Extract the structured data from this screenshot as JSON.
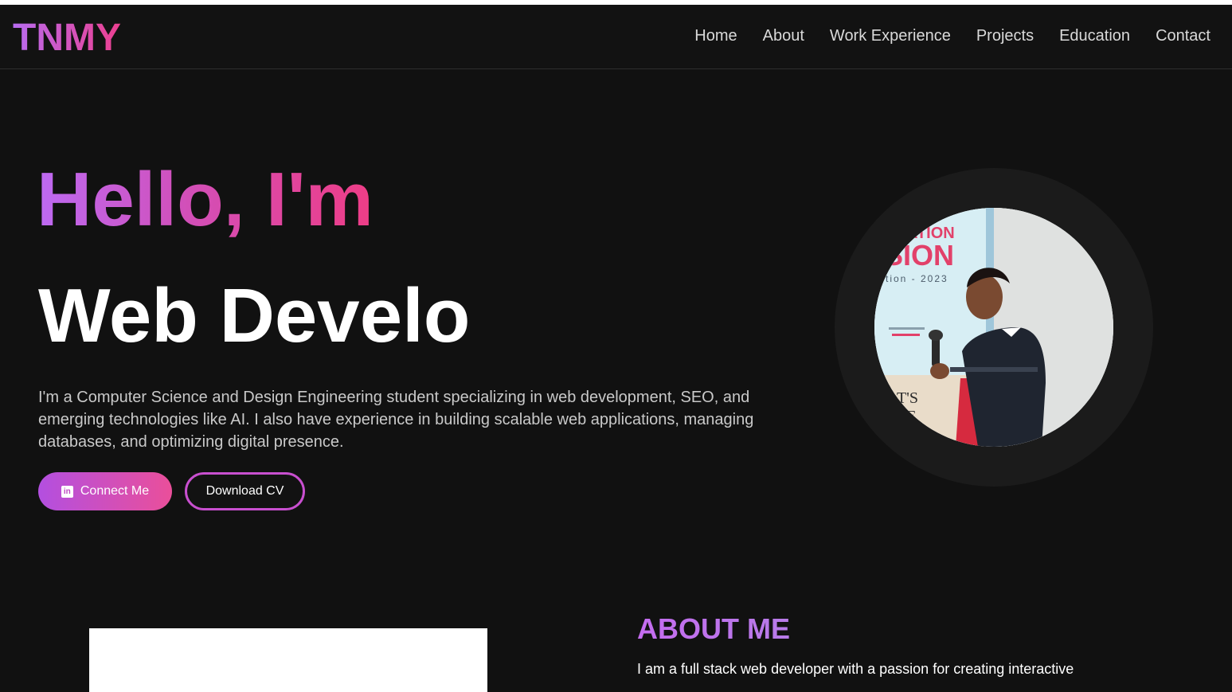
{
  "brand": {
    "logo": "TNMY"
  },
  "nav": {
    "items": [
      "Home",
      "About",
      "Work Experience",
      "Projects",
      "Education",
      "Contact"
    ]
  },
  "hero": {
    "greeting": "Hello, I'm",
    "role": "Web Develo",
    "description": "I'm a Computer Science and Design Engineering student specializing in web development, SEO, and emerging technologies like AI. I also have experience in building scalable web applications, managing databases, and optimizing digital presence.",
    "connect_label": "Connect Me",
    "cv_label": "Download CV",
    "connect_icon": "linkedin-icon",
    "photo_caption_lines": [
      "ATION",
      "SION",
      "tion - 2023",
      "T'S",
      "TE"
    ]
  },
  "about": {
    "title": "ABOUT ME",
    "text": "I am a full stack web developer with a passion for creating interactive"
  },
  "colors": {
    "background": "#111111",
    "accent_purple": "#bd6af3",
    "accent_pink": "#ee3d86"
  }
}
